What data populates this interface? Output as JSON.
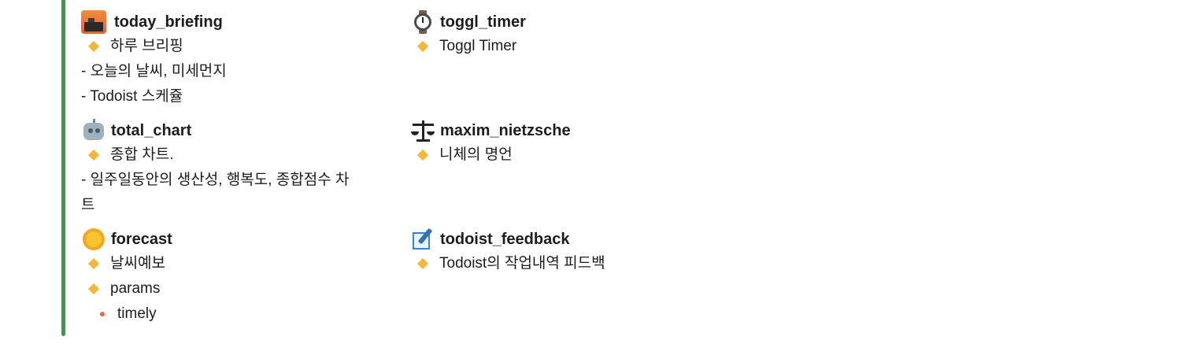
{
  "commands": {
    "left": [
      {
        "name": "today_briefing",
        "icon": "city-sunset-icon",
        "lines": [
          {
            "type": "bullet",
            "text": "하루 브리핑"
          },
          {
            "type": "plain",
            "text": "- 오늘의 날씨, 미세먼지"
          },
          {
            "type": "plain",
            "text": "- Todoist 스케쥴"
          }
        ]
      },
      {
        "name": "total_chart",
        "icon": "robot-face-icon",
        "lines": [
          {
            "type": "bullet",
            "text": "종합 차트."
          },
          {
            "type": "plain",
            "text": "- 일주일동안의 생산성, 행복도, 종합점수 차"
          },
          {
            "type": "plain",
            "text": "트"
          }
        ]
      },
      {
        "name": "forecast",
        "icon": "sun-with-face-icon",
        "lines": [
          {
            "type": "bullet",
            "text": "날씨예보"
          },
          {
            "type": "bullet",
            "text": "params"
          },
          {
            "type": "subbullet",
            "text": "timely"
          }
        ]
      }
    ],
    "right": [
      {
        "name": "toggl_timer",
        "icon": "watch-icon",
        "lines": [
          {
            "type": "bullet",
            "text": "Toggl Timer"
          }
        ]
      },
      {
        "name": "maxim_nietzsche",
        "icon": "scales-icon",
        "lines": [
          {
            "type": "bullet",
            "text": "니체의 명언"
          }
        ]
      },
      {
        "name": "todoist_feedback",
        "icon": "memo-icon",
        "lines": [
          {
            "type": "bullet",
            "text": "Todoist의 작업내역 피드백"
          }
        ]
      }
    ]
  },
  "colors": {
    "attachment_bar": "#4a8d55",
    "bullet_diamond": "#f3b83a",
    "subbullet_dot": "#e0673f"
  }
}
